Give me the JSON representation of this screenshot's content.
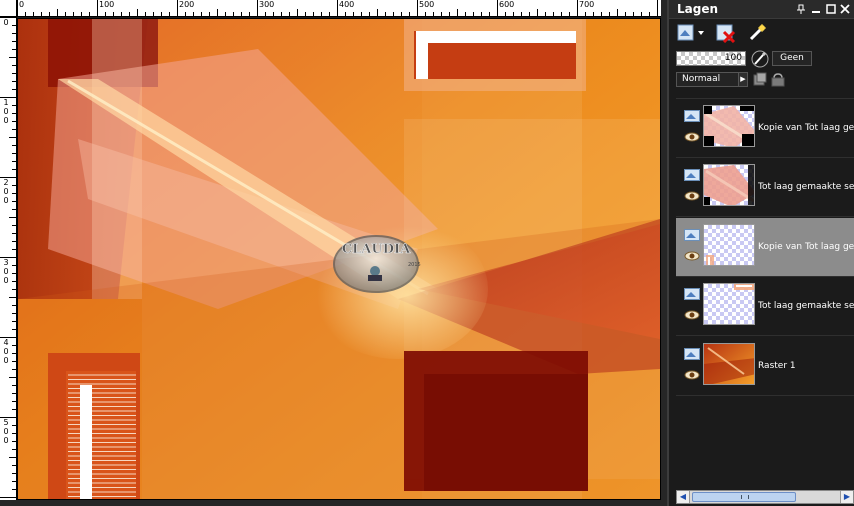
{
  "ruler": {
    "h_labels": [
      "0",
      "100",
      "200",
      "300",
      "400",
      "500",
      "600",
      "700"
    ],
    "v_labels": [
      [
        "0"
      ],
      [
        "1",
        "0",
        "0"
      ],
      [
        "2",
        "0",
        "0"
      ],
      [
        "3",
        "0",
        "0"
      ],
      [
        "4",
        "0",
        "0"
      ],
      [
        "5",
        "0",
        "0"
      ]
    ]
  },
  "canvas": {
    "watermark_text": "CLAUDIA",
    "watermark_sub": "2015",
    "colors": {
      "base_orange": "#e8861a",
      "dark_red": "#9c1a08",
      "bright_orange": "#f7a72a",
      "pink_glow": "#f4a58a",
      "white": "#ffffff"
    }
  },
  "palette": {
    "title": "Lagen",
    "title_buttons": {
      "pin": "pin-icon",
      "close": "close-icon",
      "restore": "restore-icon",
      "x": "x-icon"
    },
    "toolbar": [
      "new-layer-icon",
      "delete-layer-icon",
      "layer-properties-icon"
    ],
    "opacity_value": "100",
    "mask_label": "Geen",
    "blend_mode": "Normaal",
    "layers": [
      {
        "name": "Kopie van Tot laag gemaakte selectie",
        "selected": false,
        "thumb": "pink-diagonal"
      },
      {
        "name": "Tot laag gemaakte selectie",
        "selected": false,
        "thumb": "pink-diagonal-2"
      },
      {
        "name": "Kopie van Tot laag gemaakte selectie",
        "selected": true,
        "thumb": "frame-corner"
      },
      {
        "name": "Tot laag gemaakte selectie",
        "selected": false,
        "thumb": "frame-top"
      },
      {
        "name": "Raster 1",
        "selected": false,
        "thumb": "raster"
      }
    ],
    "colors": {
      "selected_row": "#8c8c8c",
      "panel_bg": "#1b1b1b",
      "scroll_thumb": "#bcd3f0"
    }
  }
}
